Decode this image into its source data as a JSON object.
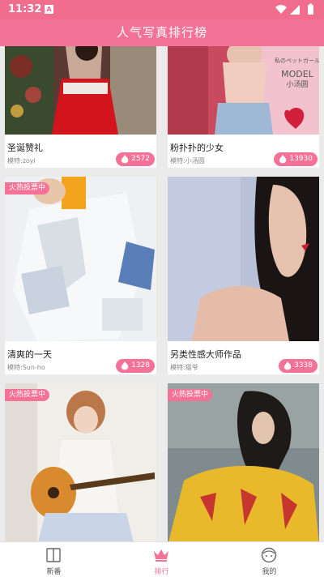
{
  "status_bar": {
    "time": "11:32",
    "notification_badge": "A"
  },
  "app_bar": {
    "title": "人气写真排行榜"
  },
  "labels": {
    "hot_badge": "火热投票中"
  },
  "cards": [
    {
      "name": "圣诞赞礼",
      "model": "模特:zoyi",
      "likes": "2572",
      "hot": false
    },
    {
      "name": "粉扑扑的少女",
      "model": "模特:小汤圆",
      "likes": "13930",
      "hot": false,
      "photo_text": [
        "私のペットガール",
        "MODEL",
        "小汤圆"
      ]
    },
    {
      "name": "清爽的一天",
      "model": "模特:Sun-ho",
      "likes": "1328",
      "hot": true
    },
    {
      "name": "另类性感大师作品",
      "model": "模特:猫爷",
      "likes": "3338",
      "hot": false
    },
    {
      "name": "",
      "model": "",
      "likes": "",
      "hot": true
    },
    {
      "name": "",
      "model": "",
      "likes": "",
      "hot": true
    }
  ],
  "tab_bar": {
    "tabs": [
      {
        "label": "新番",
        "icon": "book-icon"
      },
      {
        "label": "排行",
        "icon": "crown-icon",
        "active": true
      },
      {
        "label": "我的",
        "icon": "face-icon"
      }
    ]
  },
  "colors": {
    "accent": "#f47198",
    "status_bar": "#f06d8e",
    "background": "#ebebeb"
  }
}
